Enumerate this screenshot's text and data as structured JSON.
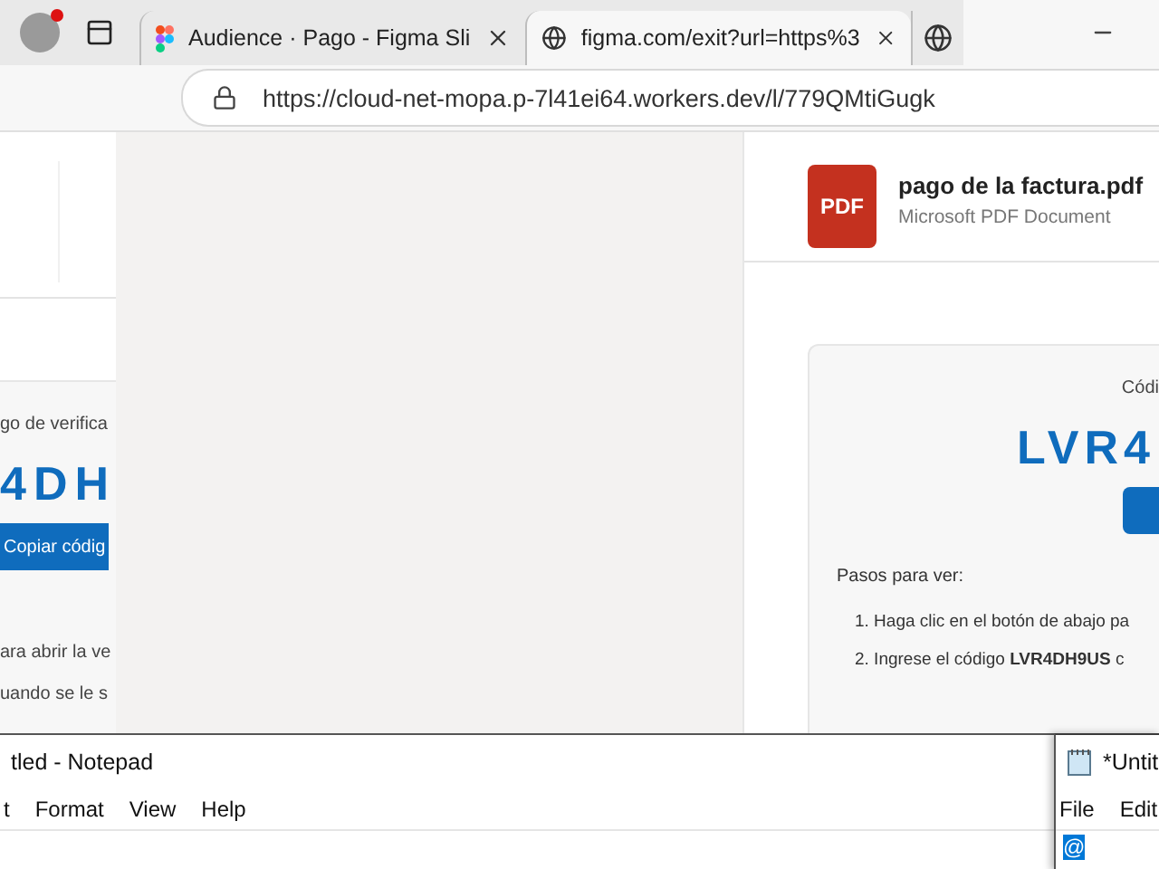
{
  "browser": {
    "profile": {
      "notification": true
    },
    "tabs": [
      {
        "kind": "figma",
        "title": "Audience · Pago - Figma Sli",
        "selected": false
      },
      {
        "kind": "globe",
        "title": "figma.com/exit?url=https%3",
        "selected": true
      },
      {
        "kind": "globe-icon-only",
        "selected": false
      }
    ],
    "address_bar": {
      "url": "https://cloud-net-mopa.p-7l41ei64.workers.dev/l/779QMtiGugk"
    }
  },
  "left_document": {
    "verification_label": "go de verifica",
    "code": "4DH",
    "copy_button": "Copiar códig",
    "steps": [
      "ara abrir la ve",
      "uando se le s"
    ]
  },
  "right_document": {
    "icon_label": "PDF",
    "file_name": "pago de la factura.pdf",
    "file_type": "Microsoft PDF Document",
    "verification_label": "Códi",
    "code": "LVR4",
    "steps_heading": "Pasos para ver:",
    "steps": [
      "1. Haga clic en el botón de abajo pa",
      "2. Ingrese el código **LVR4DH9US** c"
    ]
  },
  "notepads": [
    {
      "title": "tled - Notepad",
      "menu": [
        "t",
        "Format",
        "View",
        "Help"
      ],
      "focused": false
    },
    {
      "title": "*Untit",
      "menu": [
        "File",
        "Edit"
      ],
      "content": "@",
      "focused": true
    }
  ]
}
